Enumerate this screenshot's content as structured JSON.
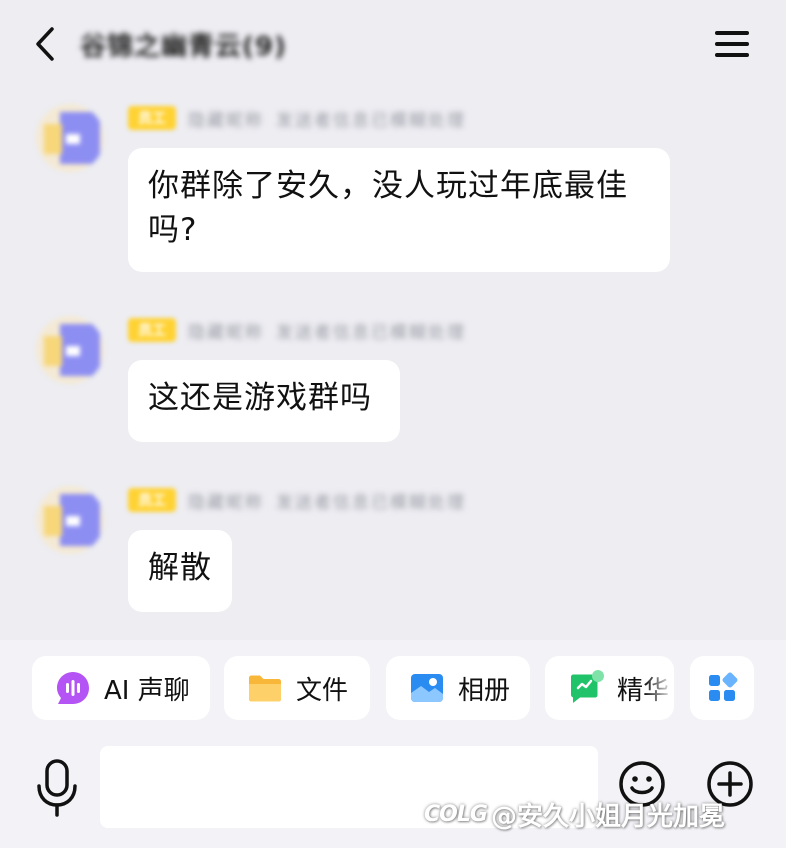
{
  "header": {
    "title": "谷锦之幽青云(9)"
  },
  "messages": [
    {
      "role_badge": "员工",
      "nickname": "隐藏昵称",
      "subtitle": "发送者信息已模糊处理",
      "text_line1": "你群除了安久，没人玩过年底最佳",
      "text_line2": "吗?"
    },
    {
      "role_badge": "员工",
      "nickname": "隐藏昵称",
      "subtitle": "发送者信息已模糊处理",
      "text_line1": "这还是游戏群吗"
    },
    {
      "role_badge": "员工",
      "nickname": "隐藏昵称",
      "subtitle": "发送者信息已模糊处理",
      "text_line1": "解散"
    }
  ],
  "shortcuts": [
    {
      "label": "AI 声聊",
      "icon": "ai-voice-chat-icon"
    },
    {
      "label": "文件",
      "icon": "folder-icon"
    },
    {
      "label": "相册",
      "icon": "photo-album-icon"
    },
    {
      "label": "精华",
      "icon": "essence-icon"
    },
    {
      "label": "",
      "icon": "apps-grid-icon"
    }
  ],
  "input": {
    "placeholder": ""
  },
  "watermark": {
    "logo": "COLG",
    "text": "@安久小姐月光加冕"
  },
  "colors": {
    "background": "#ededf2",
    "bubble": "#ffffff",
    "badge": "#ffd233",
    "ai_accent": "#b554f4",
    "folder": "#f9b73a",
    "album": "#2a8cf0",
    "essence": "#21c36a",
    "apps": "#2a8cf0"
  }
}
